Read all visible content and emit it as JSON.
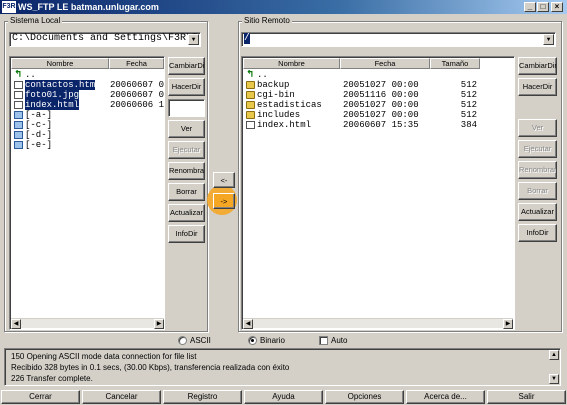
{
  "window": {
    "icon": "F3R",
    "title": "WS_FTP LE batman.unlugar.com",
    "min": "_",
    "max": "□",
    "close": "×"
  },
  "local": {
    "group_label": "Sistema Local",
    "path": "C:\\Documents and Settings\\F3R\\E",
    "columns": {
      "name": "Nombre",
      "date": "Fecha"
    },
    "rows": [
      {
        "name": "..",
        "date": "",
        "icon": "up-arrow-icon",
        "selected": false
      },
      {
        "name": "contactos.htm",
        "date": "20060607 0",
        "icon": "file-icon",
        "selected": true
      },
      {
        "name": "foto01.jpg",
        "date": "20060607 0",
        "icon": "file-icon",
        "selected": true
      },
      {
        "name": "index.html",
        "date": "20060606 1",
        "icon": "file-icon",
        "selected": true
      },
      {
        "name": "[-a-]",
        "date": "",
        "icon": "drive-icon",
        "selected": false
      },
      {
        "name": "[-c-]",
        "date": "",
        "icon": "drive-icon",
        "selected": false
      },
      {
        "name": "[-d-]",
        "date": "",
        "icon": "drive-icon",
        "selected": false
      },
      {
        "name": "[-e-]",
        "date": "",
        "icon": "drive-icon",
        "selected": false
      }
    ],
    "buttons": [
      "CambiarDir",
      "HacerDir",
      "",
      "Ver",
      "Ejecutar",
      "Renombrar",
      "Borrar",
      "Actualizar",
      "InfoDir"
    ]
  },
  "transfer": {
    "left": "<-",
    "right": "->"
  },
  "remote": {
    "group_label": "Sitio Remoto",
    "path": "/",
    "columns": {
      "name": "Nombre",
      "date": "Fecha",
      "size": "Tamaño"
    },
    "rows": [
      {
        "name": "..",
        "date": "",
        "size": "",
        "icon": "up-arrow-icon"
      },
      {
        "name": "backup",
        "date": "20051027 00:00",
        "size": "512",
        "icon": "folder-icon"
      },
      {
        "name": "cgi-bin",
        "date": "20051116 00:00",
        "size": "512",
        "icon": "folder-icon"
      },
      {
        "name": "estadisticas",
        "date": "20051027 00:00",
        "size": "512",
        "icon": "folder-icon"
      },
      {
        "name": "includes",
        "date": "20051027 00:00",
        "size": "512",
        "icon": "folder-icon"
      },
      {
        "name": "index.html",
        "date": "20060607 15:35",
        "size": "384",
        "icon": "file-icon"
      }
    ],
    "buttons": [
      "CambiarDir",
      "HacerDir",
      "Ver",
      "Ejecutar",
      "Renombrar",
      "Borrar",
      "Actualizar",
      "InfoDir"
    ]
  },
  "mode": {
    "ascii": "ASCII",
    "binary": "Binario",
    "auto": "Auto",
    "selected": "Binario"
  },
  "log": [
    "150 Opening ASCII mode data connection for file list",
    "Recibido 328 bytes in 0.1 secs, (30.00 Kbps), transferencia realizada con éxito",
    "226 Transfer complete."
  ],
  "bottom_buttons": [
    "Cerrar",
    "Cancelar",
    "Registro",
    "Ayuda",
    "Opciones",
    "Acerca de...",
    "Salir"
  ],
  "colors": {
    "title_start": "#0a246a",
    "title_end": "#a6caf0",
    "selection": "#0a246a",
    "highlight": "#f5a623"
  }
}
